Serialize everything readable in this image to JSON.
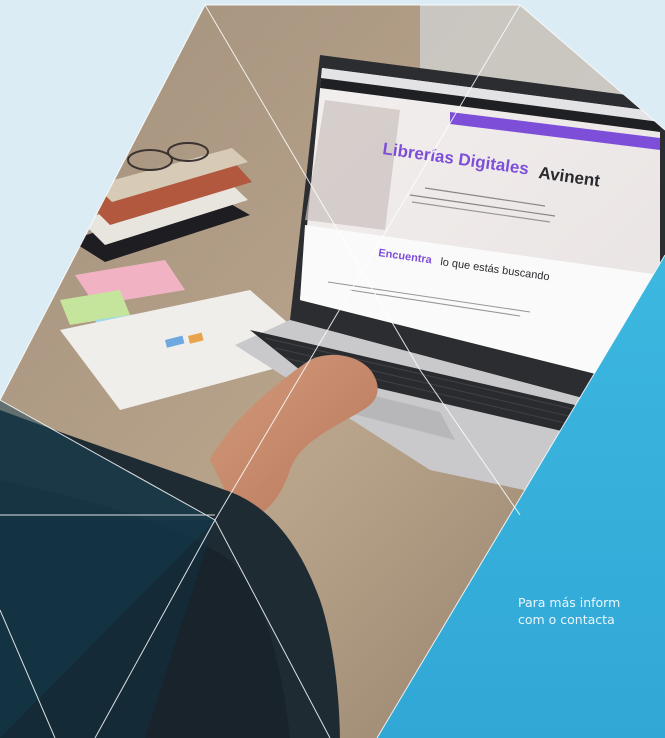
{
  "site": {
    "brand_title_accent": "Librerías Digitales",
    "brand_title_rest": "Avinent",
    "section_title_accent": "Encuentra",
    "section_title_rest": "lo que estás buscando"
  },
  "contact": {
    "line1": "Para más inform",
    "line2": "com o contacta"
  },
  "colors": {
    "accent_purple": "#7d4fd8",
    "panel_cyan": "#38b2dc",
    "background": "#dcecf5"
  }
}
